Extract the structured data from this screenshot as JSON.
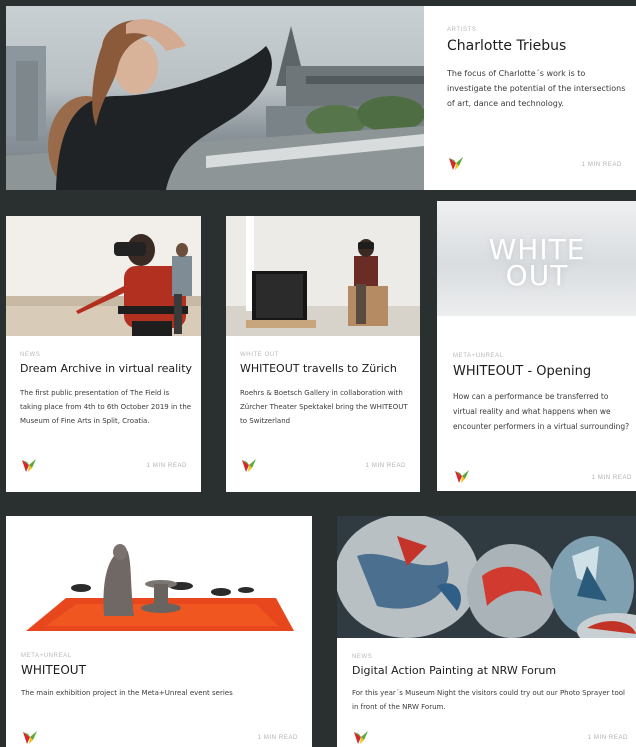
{
  "cards": [
    {
      "category": "ARTISTS",
      "title": "Charlotte Triebus",
      "description": "The focus of Charlotte´s work is to investigate the potential of the intersections of art, dance and technology.",
      "read_time": "1 MIN READ",
      "image": "photo-woman-rooftop"
    },
    {
      "category": "NEWS",
      "title": "Dream Archive in virtual reality",
      "description": "The first public presentation of The Field is taking place from 4th to 6th October 2019 in the Museum of Fine Arts in Split, Croatia.",
      "read_time": "1 MIN READ",
      "image": "photo-vr-headset-woman"
    },
    {
      "category": "WHITE OUT",
      "title": "WHITEOUT travells to Zürich",
      "description": "Roehrs & Boetsch Gallery in collaboration with Zürcher Theater Spektakel bring the WHITEOUT to Switzerland",
      "read_time": "1 MIN READ",
      "image": "photo-gallery-vr-seated"
    },
    {
      "category": "META+UNREAL",
      "title": "WHITEOUT - Opening",
      "description": "How can a performance be transferred to virtual reality and what happens when we encounter performers in a virtual surrounding?",
      "read_time": "1 MIN READ",
      "image_text": "WHITE OUT"
    },
    {
      "category": "META+UNREAL",
      "title": "WHITEOUT",
      "description": "The main exhibition project in the Meta+Unreal event series",
      "read_time": "1 MIN READ",
      "image": "render-figure-orange-floor"
    },
    {
      "category": "NEWS",
      "title": "Digital Action Painting at NRW Forum",
      "description": "For this year´s Museum Night the visitors could try out our Photo Sprayer tool in front of the NRW Forum.",
      "read_time": "1 MIN READ",
      "image": "photo-painted-spheres"
    }
  ],
  "colors": {
    "background": "#2a2f30",
    "card": "#ffffff",
    "logo_red": "#d8262c",
    "logo_green": "#5aa83a",
    "logo_yellow": "#f2c21b",
    "floor_orange": "#e8471d"
  }
}
